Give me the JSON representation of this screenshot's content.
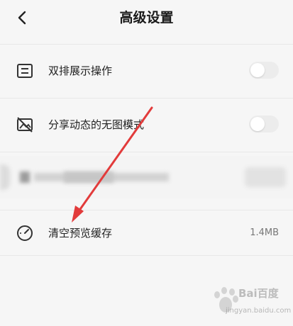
{
  "header": {
    "title": "高级设置"
  },
  "settings": [
    {
      "label": "双排展示操作",
      "icon": "list-icon",
      "control": "toggle",
      "enabled": false
    },
    {
      "label": "分享动态的无图模式",
      "icon": "no-image-icon",
      "control": "toggle",
      "enabled": false
    },
    {
      "label": "清空预览缓存",
      "icon": "speedometer-icon",
      "control": "value",
      "value": "1.4MB"
    }
  ],
  "watermark": {
    "brand": "Bai百度",
    "sub": "jingyan.baidu.com"
  },
  "colors": {
    "background": "#f6f6f6",
    "arrow": "#e23b3b",
    "toggle_off": "#ececec"
  }
}
